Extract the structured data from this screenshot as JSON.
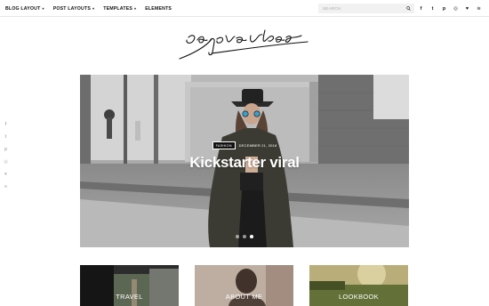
{
  "nav": {
    "items": [
      {
        "label": "BLOG LAYOUT",
        "has_caret": true
      },
      {
        "label": "POST LAYOUTS",
        "has_caret": true
      },
      {
        "label": "TEMPLATES",
        "has_caret": true
      },
      {
        "label": "ELEMENTS",
        "has_caret": false
      }
    ],
    "caret": "▾"
  },
  "search": {
    "placeholder": "SEARCH"
  },
  "social": {
    "icons": [
      "facebook-icon",
      "twitter-icon",
      "pinterest-icon",
      "instagram-icon",
      "heart-icon",
      "rss-icon"
    ],
    "glyphs": {
      "facebook": "f",
      "twitter": "t",
      "pinterest": "p",
      "instagram": "◎",
      "heart": "♥",
      "rss": "≋"
    }
  },
  "logo": {
    "alt": "signature logo"
  },
  "hero": {
    "tag": "FASHION",
    "date": "DECEMBER 21, 2018",
    "title": "Kickstarter viral",
    "slides": 3,
    "active_slide": 3
  },
  "cards": [
    {
      "label": "TRAVEL"
    },
    {
      "label": "ABOUT ME"
    },
    {
      "label": "LOOKBOOK"
    }
  ],
  "colors": {
    "accent": "#111111",
    "nav_bg": "#ffffff",
    "search_bg": "#f1f1f1"
  }
}
